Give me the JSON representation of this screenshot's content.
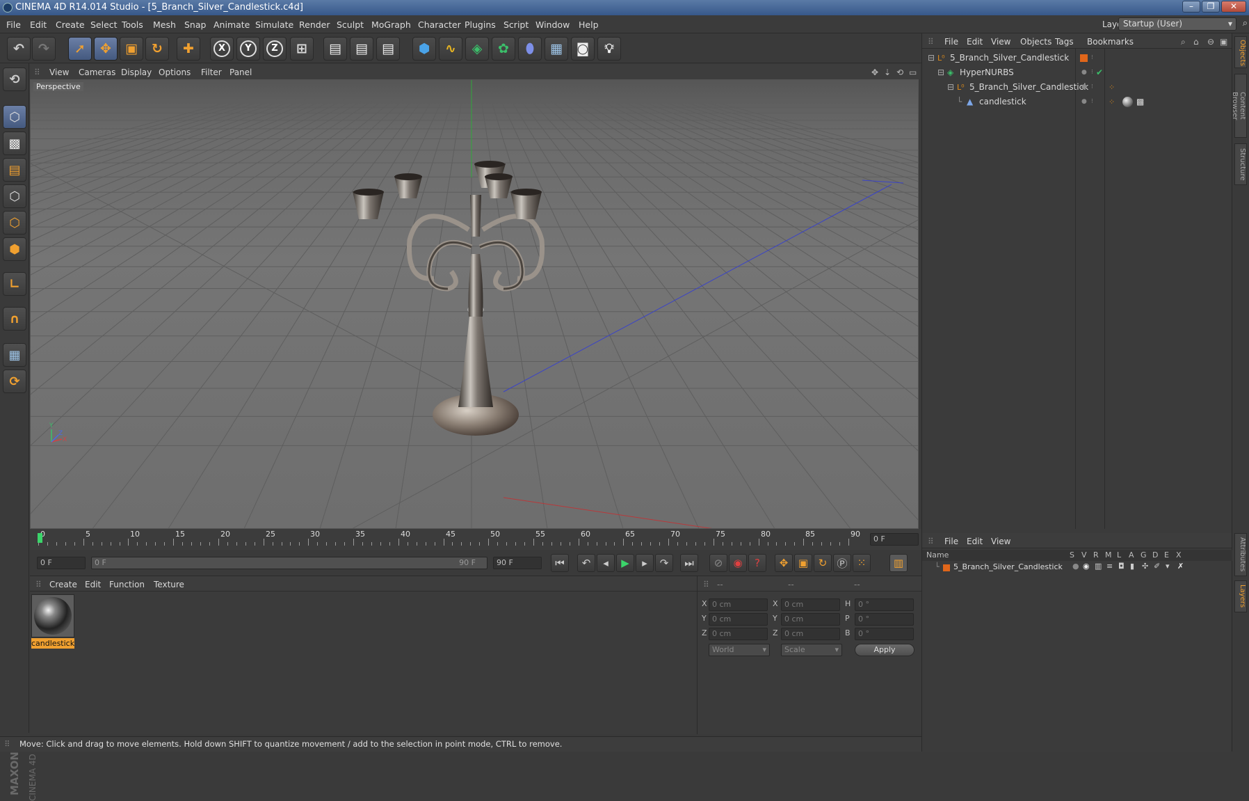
{
  "window": {
    "title": "CINEMA 4D R14.014 Studio - [5_Branch_Silver_Candlestick.c4d]",
    "minimize": "–",
    "maximize": "❐",
    "close": "✕"
  },
  "menu": [
    "File",
    "Edit",
    "Create",
    "Select",
    "Tools",
    "Mesh",
    "Snap",
    "Animate",
    "Simulate",
    "Render",
    "Sculpt",
    "MoGraph",
    "Character",
    "Plugins",
    "Script",
    "Window",
    "Help"
  ],
  "layout": {
    "label": "Layout:",
    "value": "Startup (User)"
  },
  "toolbar": {
    "axis_x": "X",
    "axis_y": "Y",
    "axis_z": "Z"
  },
  "viewport": {
    "menu": [
      "View",
      "Cameras",
      "Display",
      "Options",
      "Filter",
      "Panel"
    ],
    "label": "Perspective",
    "axes": {
      "x": "X",
      "y": "Y",
      "z": "Z"
    }
  },
  "objects_panel": {
    "menu": [
      "File",
      "Edit",
      "View",
      "Objects",
      "Tags",
      "Bookmarks"
    ],
    "rows": [
      {
        "name": "5_Branch_Silver_Candlestick",
        "type": "null"
      },
      {
        "name": "HyperNURBS",
        "type": "hypernurbs"
      },
      {
        "name": "5_Branch_Silver_Candlestick",
        "type": "null"
      },
      {
        "name": "candlestick",
        "type": "polygon"
      }
    ]
  },
  "right_tabs": [
    "Objects",
    "Content Browser",
    "Structure",
    "Attributes",
    "Layers"
  ],
  "timeline": {
    "ticks": [
      "0",
      "5",
      "10",
      "15",
      "20",
      "25",
      "30",
      "35",
      "40",
      "45",
      "50",
      "55",
      "60",
      "65",
      "70",
      "75",
      "80",
      "85",
      "90"
    ],
    "current_frame": "0 F"
  },
  "transport": {
    "start_field": "0 F",
    "range_start": "0 F",
    "range_end": "90 F",
    "end_field": "90 F"
  },
  "material_panel": {
    "menu": [
      "Create",
      "Edit",
      "Function",
      "Texture"
    ],
    "material_name": "candlestick"
  },
  "coordinates": {
    "headers": [
      "--",
      "--",
      "--"
    ],
    "labels": {
      "x": "X",
      "y": "Y",
      "z": "Z",
      "x2": "X",
      "y2": "Y",
      "z2": "Z",
      "h": "H",
      "p": "P",
      "b": "B"
    },
    "pos": [
      "0 cm",
      "0 cm",
      "0 cm"
    ],
    "size": [
      "0 cm",
      "0 cm",
      "0 cm"
    ],
    "rot": [
      "0 °",
      "0 °",
      "0 °"
    ],
    "mode_world": "World",
    "mode_scale": "Scale",
    "apply": "Apply"
  },
  "layers_panel": {
    "menu": [
      "File",
      "Edit",
      "View"
    ],
    "col_name": "Name",
    "cols": [
      "S",
      "V",
      "R",
      "M",
      "L",
      "A",
      "G",
      "D",
      "E",
      "X"
    ],
    "row": "5_Branch_Silver_Candlestick"
  },
  "maxon": {
    "brand": "MAXON",
    "product": "CINEMA 4D"
  },
  "status": "Move: Click and drag to move elements. Hold down SHIFT to quantize movement / add to the selection in point mode, CTRL to remove.",
  "colors": {
    "accent": "#f0a030",
    "selection": "#5a7398",
    "null_icon": "#e08c1a",
    "hypernurbs": "#3bbf6a"
  }
}
